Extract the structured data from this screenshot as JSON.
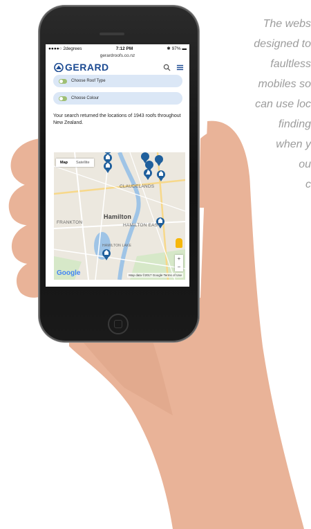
{
  "caption": {
    "lines": [
      "The webs",
      "designed to",
      "faultless",
      "mobiles so",
      "can use loc",
      "finding",
      "when y",
      "ou",
      "c"
    ]
  },
  "status": {
    "carrier": "●●●●○ 2degrees",
    "time": "7:12 PM",
    "battery": "97%"
  },
  "url": "gerardroofs.co.nz",
  "site": {
    "brand": "GERARD",
    "brand_color": "#1b4a92"
  },
  "filters": [
    {
      "label": "Choose Roof Type"
    },
    {
      "label": "Choose Colour"
    }
  ],
  "result_text": "Your search returned the locations of 1943 roofs throughout New Zealand.",
  "map": {
    "tab_map": "Map",
    "tab_satellite": "Satellite",
    "labels": {
      "claudelands": "CLAUDELANDS",
      "hamilton": "Hamilton",
      "frankton": "FRANKTON",
      "hamilton_east": "HAMILTON EAST",
      "hamilton_lake": "HAMILTON LAKE"
    },
    "google": "Google",
    "footer": "Map data ©2017 Google   Terms of Use",
    "zoom_in": "+",
    "zoom_out": "−",
    "pin_color": "#1f5f9c"
  }
}
